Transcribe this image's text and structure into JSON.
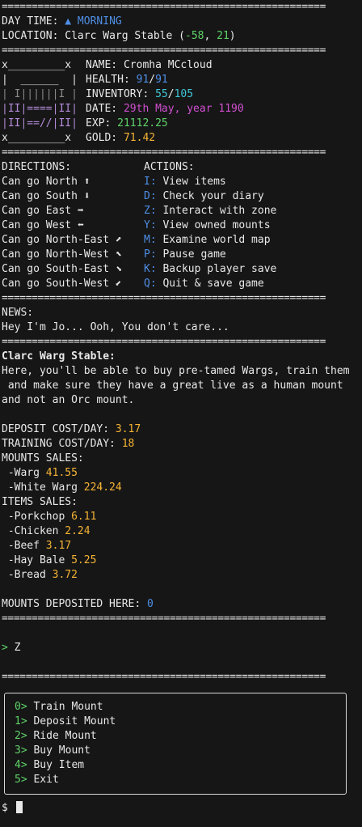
{
  "separator": "======================================================",
  "header": {
    "day_time_label": "DAY TIME: ",
    "day_time_value": "▲ MORNING",
    "location_label": "LOCATION: ",
    "location_name": "Clarc Warg Stable (",
    "location_x": "-58",
    "location_sep": ", ",
    "location_y": "21",
    "location_close": ")"
  },
  "ascii_art": [
    "x_________x",
    "|  ______  |",
    "| I||||||I |",
    "|II|====|II|",
    "|II|==//|II|",
    "x_________x"
  ],
  "stats": {
    "name_label": "NAME: ",
    "name_value": "Cromha MCcloud",
    "health_label": "HEALTH: ",
    "health_current": "91",
    "health_max": "91",
    "inventory_label": "INVENTORY: ",
    "inventory_current": "55",
    "inventory_max": "105",
    "date_label": "DATE: ",
    "date_value": "29th May, year 1190",
    "exp_label": "EXP: ",
    "exp_value": "21112.25",
    "gold_label": "GOLD: ",
    "gold_value": "71.42"
  },
  "directions": {
    "title": "DIRECTIONS:",
    "items": [
      "Can go North ⬆",
      "Can go South ⬇",
      "Can go East ➡",
      "Can go West ⬅",
      "Can go North-East ⬈",
      "Can go North-West ⬉",
      "Can go South-East ⬊",
      "Can go South-West ⬋"
    ]
  },
  "actions": {
    "title": "ACTIONS:",
    "items": [
      {
        "key": "I:",
        "label": " View items"
      },
      {
        "key": "D:",
        "label": " Check your diary"
      },
      {
        "key": "Z:",
        "label": " Interact with zone"
      },
      {
        "key": "Y:",
        "label": " View owned mounts"
      },
      {
        "key": "M:",
        "label": " Examine world map"
      },
      {
        "key": "P:",
        "label": " Pause game"
      },
      {
        "key": "K:",
        "label": " Backup player save"
      },
      {
        "key": "Q:",
        "label": " Quit & save game"
      }
    ]
  },
  "news": {
    "title": "NEWS:",
    "text": "Hey I'm Jo... Ooh, You don't care..."
  },
  "zone": {
    "title": "Clarc Warg Stable:",
    "desc": [
      "Here, you'll be able to buy pre-tamed Wargs, train them",
      " and make sure they have a great live as a human mount",
      "and not an Orc mount."
    ],
    "deposit_label": "DEPOSIT COST/DAY: ",
    "deposit_value": "3.17",
    "training_label": "TRAINING COST/DAY: ",
    "training_value": "18",
    "mounts_sales_title": "MOUNTS SALES:",
    "mounts": [
      {
        "name": " -Warg ",
        "price": "41.55"
      },
      {
        "name": " -White Warg ",
        "price": "224.24"
      }
    ],
    "items_sales_title": "ITEMS SALES:",
    "items": [
      {
        "name": " -Porkchop ",
        "price": "6.11"
      },
      {
        "name": " -Chicken ",
        "price": "2.24"
      },
      {
        "name": " -Beef ",
        "price": "3.17"
      },
      {
        "name": " -Hay Bale ",
        "price": "5.25"
      },
      {
        "name": " -Bread ",
        "price": "3.72"
      }
    ],
    "deposited_label": "MOUNTS DEPOSITED HERE: ",
    "deposited_value": "0"
  },
  "input": {
    "prompt": "> ",
    "value": "Z"
  },
  "menu": [
    {
      "key": "0>",
      "label": " Train Mount"
    },
    {
      "key": "1>",
      "label": " Deposit Mount"
    },
    {
      "key": "2>",
      "label": " Ride Mount"
    },
    {
      "key": "3>",
      "label": " Buy Mount"
    },
    {
      "key": "4>",
      "label": " Buy Item"
    },
    {
      "key": "5>",
      "label": " Exit"
    }
  ],
  "shell_prompt": "$ ",
  "colors": {
    "background": "#161616",
    "blue": "#4f8fe6",
    "cyan": "#3fc6d6",
    "green": "#5fd26a",
    "orange": "#f5b335",
    "magenta": "#d14fd1"
  }
}
